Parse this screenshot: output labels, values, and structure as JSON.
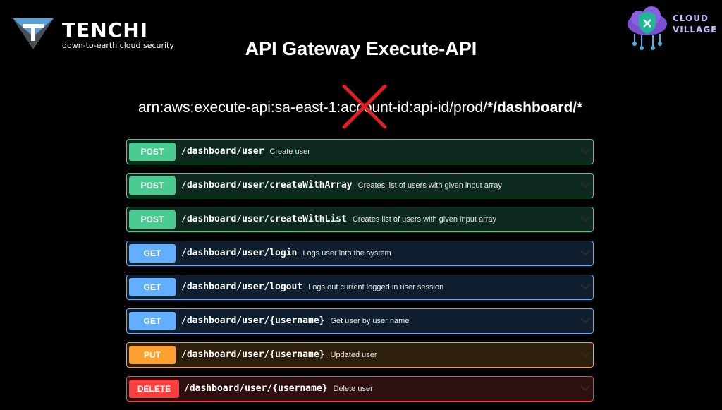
{
  "branding": {
    "left_name": "TENCHI",
    "left_tagline": "down-to-earth cloud security",
    "right_line1": "CLOUD",
    "right_line2": "VILLAGE"
  },
  "title": "API Gateway Execute-API",
  "arn": {
    "prefix": "arn:aws:execute-api:sa-east-1:account-id:api-id/prod/",
    "suffix": "*/dashboard/*"
  },
  "endpoints": [
    {
      "method": "POST",
      "path": "/dashboard/user",
      "summary": "Create user"
    },
    {
      "method": "POST",
      "path": "/dashboard/user/createWithArray",
      "summary": "Creates list of users with given input array"
    },
    {
      "method": "POST",
      "path": "/dashboard/user/createWithList",
      "summary": "Creates list of users with given input array"
    },
    {
      "method": "GET",
      "path": "/dashboard/user/login",
      "summary": "Logs user into the system"
    },
    {
      "method": "GET",
      "path": "/dashboard/user/logout",
      "summary": "Logs out current logged in user session"
    },
    {
      "method": "GET",
      "path": "/dashboard/user/{username}",
      "summary": "Get user by user name"
    },
    {
      "method": "PUT",
      "path": "/dashboard/user/{username}",
      "summary": "Updated user"
    },
    {
      "method": "DELETE",
      "path": "/dashboard/user/{username}",
      "summary": "Delete user"
    }
  ],
  "colors": {
    "post": "#49cc90",
    "get": "#61affe",
    "put": "#fca130",
    "delete": "#f93e3e",
    "cross": "#e02020"
  },
  "icons": [
    "tenchi-logo-icon",
    "cloud-village-shield-icon",
    "cross-mark-icon",
    "chevron-down-icon"
  ]
}
